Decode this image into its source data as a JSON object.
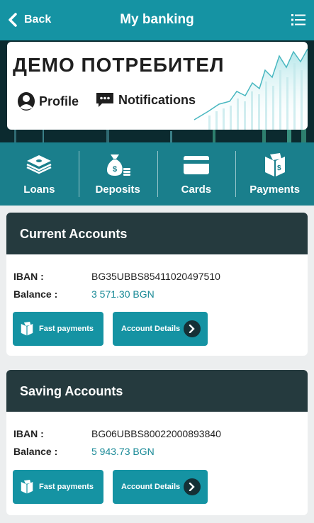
{
  "header": {
    "back_label": "Back",
    "title": "My banking",
    "menu_icon": "menu-icon"
  },
  "hero": {
    "user_name": "ДЕМО ПОТРЕБИТЕЛ",
    "profile_label": "Profile",
    "notifications_label": "Notifications"
  },
  "nav": {
    "items": [
      {
        "label": "Loans",
        "icon": "money-stack-icon"
      },
      {
        "label": "Deposits",
        "icon": "money-bag-icon"
      },
      {
        "label": "Cards",
        "icon": "card-icon"
      },
      {
        "label": "Payments",
        "icon": "payments-icon"
      }
    ]
  },
  "accounts": [
    {
      "title": "Current Accounts",
      "iban_label": "IBAN :",
      "iban": "BG35UBBS85411020497510",
      "balance_label": "Balance :",
      "balance": "3 571.30 BGN",
      "fast_payments_label": "Fast payments",
      "details_label": "Account Details"
    },
    {
      "title": "Saving Accounts",
      "iban_label": "IBAN :",
      "iban": "BG06UBBS80022000893840",
      "balance_label": "Balance :",
      "balance": "5 943.73 BGN",
      "fast_payments_label": "Fast payments",
      "details_label": "Account Details"
    }
  ],
  "colors": {
    "accent": "#1593a3",
    "nav_bg": "#1a7f8c",
    "section_header": "#253a3e",
    "money": "#1a8a97"
  }
}
